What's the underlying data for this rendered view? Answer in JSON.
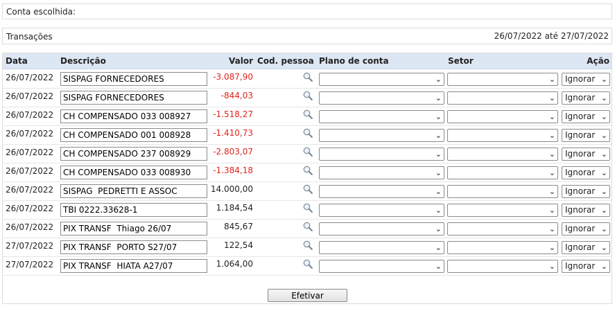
{
  "conta_label": "Conta escolhida:",
  "transacoes": {
    "label": "Transações",
    "period": "26/07/2022 até 27/07/2022"
  },
  "headers": {
    "data": "Data",
    "descricao": "Descrição",
    "valor": "Valor",
    "cod_pessoa": "Cod. pessoa",
    "plano": "Plano de conta",
    "setor": "Setor",
    "acao": "Ação"
  },
  "rows": [
    {
      "date": "26/07/2022",
      "desc": "SISPAG FORNECEDORES",
      "value": "-3.087,90",
      "negative": true,
      "plano": "",
      "setor": "",
      "acao": "Ignorar"
    },
    {
      "date": "26/07/2022",
      "desc": "SISPAG FORNECEDORES",
      "value": "-844,03",
      "negative": true,
      "plano": "",
      "setor": "",
      "acao": "Ignorar"
    },
    {
      "date": "26/07/2022",
      "desc": "CH COMPENSADO 033 008927",
      "value": "-1.518,27",
      "negative": true,
      "plano": "",
      "setor": "",
      "acao": "Ignorar"
    },
    {
      "date": "26/07/2022",
      "desc": "CH COMPENSADO 001 008928",
      "value": "-1.410,73",
      "negative": true,
      "plano": "",
      "setor": "",
      "acao": "Ignorar"
    },
    {
      "date": "26/07/2022",
      "desc": "CH COMPENSADO 237 008929",
      "value": "-2.803,07",
      "negative": true,
      "plano": "",
      "setor": "",
      "acao": "Ignorar"
    },
    {
      "date": "26/07/2022",
      "desc": "CH COMPENSADO 033 008930",
      "value": "-1.384,18",
      "negative": true,
      "plano": "",
      "setor": "",
      "acao": "Ignorar"
    },
    {
      "date": "26/07/2022",
      "desc": "SISPAG  PEDRETTI E ASSOC",
      "value": "14.000,00",
      "negative": false,
      "plano": "",
      "setor": "",
      "acao": "Ignorar"
    },
    {
      "date": "26/07/2022",
      "desc": "TBI 0222.33628-1",
      "value": "1.184,54",
      "negative": false,
      "plano": "",
      "setor": "",
      "acao": "Ignorar"
    },
    {
      "date": "26/07/2022",
      "desc": "PIX TRANSF  Thiago 26/07",
      "value": "845,67",
      "negative": false,
      "plano": "",
      "setor": "",
      "acao": "Ignorar"
    },
    {
      "date": "27/07/2022",
      "desc": "PIX TRANSF  PORTO S27/07",
      "value": "122,54",
      "negative": false,
      "plano": "",
      "setor": "",
      "acao": "Ignorar"
    },
    {
      "date": "27/07/2022",
      "desc": "PIX TRANSF  HIATA A27/07",
      "value": "1.064,00",
      "negative": false,
      "plano": "",
      "setor": "",
      "acao": "Ignorar"
    }
  ],
  "icons": {
    "lookup": "magnifier-icon",
    "dropdown": "chevron-down-icon"
  },
  "colors": {
    "negative": "#e0231b",
    "header_bg": "#dde6f3"
  },
  "submit_label": "Efetivar"
}
